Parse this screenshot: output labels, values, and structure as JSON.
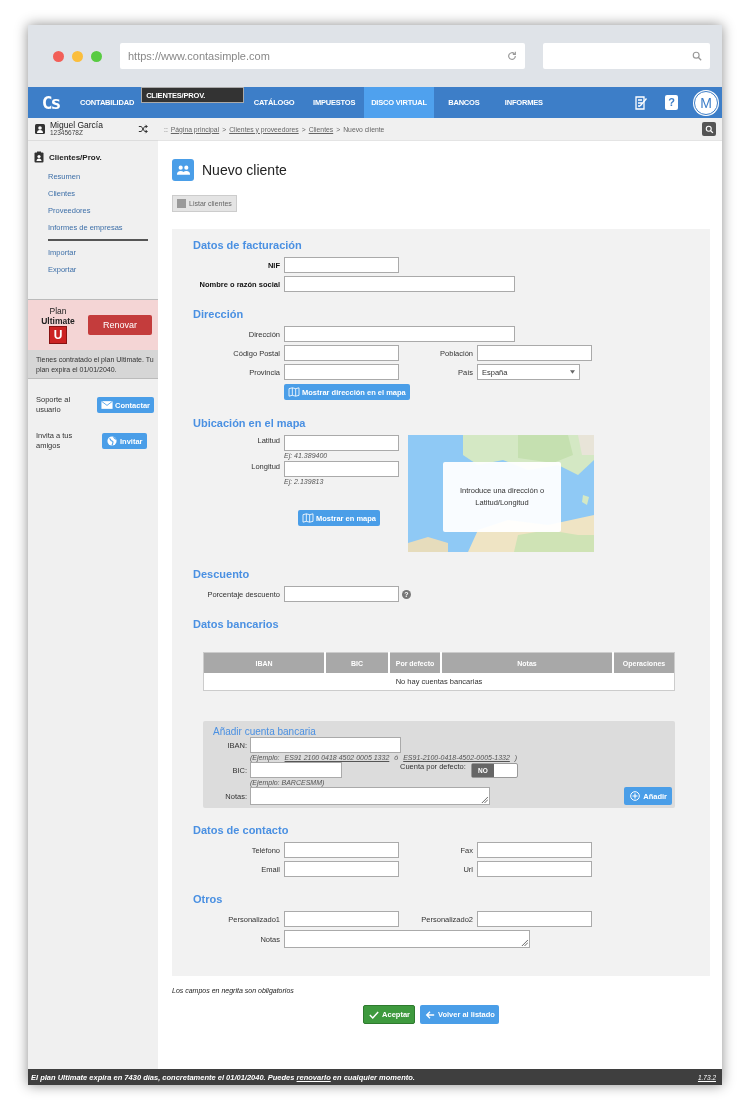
{
  "browser": {
    "url": "https://www.contasimple.com"
  },
  "nav": {
    "logo": "Cs",
    "items": [
      {
        "label": "CONTABILIDAD",
        "selected": false,
        "highlighted": false
      },
      {
        "label": "CLIENTES/PROV.",
        "selected": true,
        "highlighted": false
      },
      {
        "label": "CATÁLOGO",
        "selected": false,
        "highlighted": false
      },
      {
        "label": "IMPUESTOS",
        "selected": false,
        "highlighted": false
      },
      {
        "label": "DISCO VIRTUAL",
        "selected": false,
        "highlighted": true
      },
      {
        "label": "BANCOS",
        "selected": false,
        "highlighted": false
      },
      {
        "label": "INFORMES",
        "selected": false,
        "highlighted": false
      }
    ],
    "help": "?",
    "avatar": "M"
  },
  "user": {
    "name": "Miguel García",
    "id": "12345678Z"
  },
  "breadcrumb": [
    {
      "label": "::",
      "kind": "sep"
    },
    {
      "label": "Página principal",
      "kind": "link"
    },
    {
      "label": ">",
      "kind": "sep"
    },
    {
      "label": "Clientes y proveedores",
      "kind": "link"
    },
    {
      "label": ">",
      "kind": "sep"
    },
    {
      "label": "Clientes",
      "kind": "link"
    },
    {
      "label": ">",
      "kind": "sep"
    },
    {
      "label": "Nuevo cliente",
      "kind": "current"
    }
  ],
  "sidebar": {
    "title": "Clientes/Prov.",
    "groups": [
      [
        "Resumen",
        "Clientes",
        "Proveedores",
        "Informes de empresas"
      ],
      [
        "Importar",
        "Exportar"
      ]
    ]
  },
  "plan": {
    "label": "Plan",
    "name": "Ultimate",
    "badge": "U",
    "button": "Renovar",
    "note": "Tienes contratado el plan Ultimate. Tu plan expira el 01/01/2040."
  },
  "support": [
    {
      "text": "Soporte al usuario",
      "button": "Contactar",
      "kind": "mail"
    },
    {
      "text": "Invita a tus amigos",
      "button": "Invitar",
      "kind": "globe"
    }
  ],
  "page": {
    "title": "Nuevo cliente",
    "list_button": "Listar clientes"
  },
  "billing": {
    "title": "Datos de facturación",
    "fields": [
      {
        "label": "NIF",
        "required": true,
        "kind": "text"
      },
      {
        "label": "Nombre o razón social",
        "required": true,
        "kind": "wide"
      }
    ]
  },
  "address": {
    "title": "Dirección",
    "fields": [
      {
        "label": "Dirección",
        "required": false,
        "kind": "wide"
      },
      {
        "label": "Código Postal",
        "required": false,
        "kind": "text"
      },
      {
        "label": "Población",
        "required": false,
        "kind": "text"
      },
      {
        "label": "Provincia",
        "required": false,
        "kind": "text"
      },
      {
        "label": "País",
        "required": false,
        "kind": "select",
        "value": "España"
      }
    ],
    "button": "Mostrar dirección en el mapa"
  },
  "location": {
    "title": "Ubicación en el mapa",
    "fields": [
      {
        "label": "Latitud",
        "hint": "Ej: 41.389400"
      },
      {
        "label": "Longitud",
        "hint": "Ej: 2.139813"
      }
    ],
    "button": "Mostrar en mapa",
    "map_message": "Introduce una dirección o Latitud/Longitud"
  },
  "discount": {
    "title": "Descuento",
    "label": "Porcentaje descuento",
    "help": "?"
  },
  "bank": {
    "title": "Datos bancarios",
    "columns": [
      "IBAN",
      "BIC",
      "Por defecto",
      "Notas",
      "Operaciones"
    ],
    "empty": "No hay cuentas bancarias",
    "add": {
      "title": "Añadir cuenta bancaria",
      "iban_label": "IBAN:",
      "iban_hint": [
        {
          "text": "(Ejemplo:",
          "underline": false
        },
        {
          "text": "ES91 2100 0418 4502 0005 1332",
          "underline": true
        },
        {
          "text": "ó",
          "underline": false
        },
        {
          "text": "ES91-2100-0418-4502-0005-1332",
          "underline": true
        },
        {
          "text": ")",
          "underline": false
        }
      ],
      "bic_label": "BIC:",
      "bic_hint": "(Ejemplo: BARCESMM)",
      "default_label": "Cuenta por defecto:",
      "default_toggle": {
        "label": "NO",
        "on": false
      },
      "notes_label": "Notas:",
      "button": "Añadir"
    }
  },
  "contact": {
    "title": "Datos de contacto",
    "fields": [
      {
        "label": "Teléfono",
        "required": false,
        "kind": "text"
      },
      {
        "label": "Fax",
        "required": false,
        "kind": "text"
      },
      {
        "label": "Email",
        "required": false,
        "kind": "text"
      },
      {
        "label": "Url",
        "required": false,
        "kind": "text"
      }
    ]
  },
  "others": {
    "title": "Otros",
    "fields": [
      {
        "label": "Personalizado1",
        "required": false,
        "kind": "text"
      },
      {
        "label": "Personalizado2",
        "required": false,
        "kind": "text"
      },
      {
        "label": "Notas",
        "required": false,
        "kind": "textarea"
      }
    ]
  },
  "required_note": "Los campos en negrita son obligatorios",
  "actions": [
    {
      "label": "Aceptar",
      "kind": "accept"
    },
    {
      "label": "Volver al listado",
      "kind": "back"
    }
  ],
  "status_bar": {
    "before": "El plan Ultimate expira en 7430 días, concretamente el 01/01/2040. Puedes",
    "link": "renovarlo",
    "after": "en cualquier momento.",
    "version": "1.73.2"
  }
}
